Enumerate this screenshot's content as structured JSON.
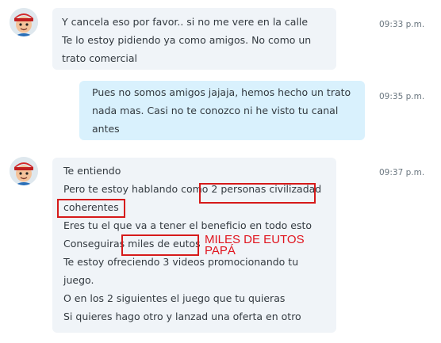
{
  "messages": [
    {
      "id": "m1",
      "direction": "incoming",
      "time": "09:33 p.m.",
      "lines": [
        "Y cancela eso por favor.. si no me vere en la calle",
        "Te lo estoy pidiendo ya como amigos. No como un",
        "trato comercial"
      ]
    },
    {
      "id": "m2",
      "direction": "outgoing",
      "time": "09:35 p.m.",
      "lines": [
        "Pues no somos amigos jajaja, hemos hecho un trato",
        "nada mas. Casi no te conozco ni he visto tu canal",
        "antes"
      ]
    },
    {
      "id": "m3",
      "direction": "incoming",
      "time": "09:37 p.m.",
      "lines": [
        "Te entiendo",
        "Pero te estoy hablando como 2 personas civilizadad",
        "coherentes",
        "Eres tu el que va a tener el beneficio en todo esto",
        "Conseguiras miles de eutos",
        "Te estoy ofreciendo 3 videos promocionando tu",
        "juego.",
        "O en los 2 siguientes el juego que tu quieras",
        "Si quieres hago otro y lanzad una oferta en otro"
      ]
    }
  ],
  "annotation": {
    "line1": "MILES DE EUTOS",
    "line2": "PAPÁ",
    "color": "#e0141e"
  },
  "icons": {
    "avatar": "cartoon-avatar-icon"
  }
}
